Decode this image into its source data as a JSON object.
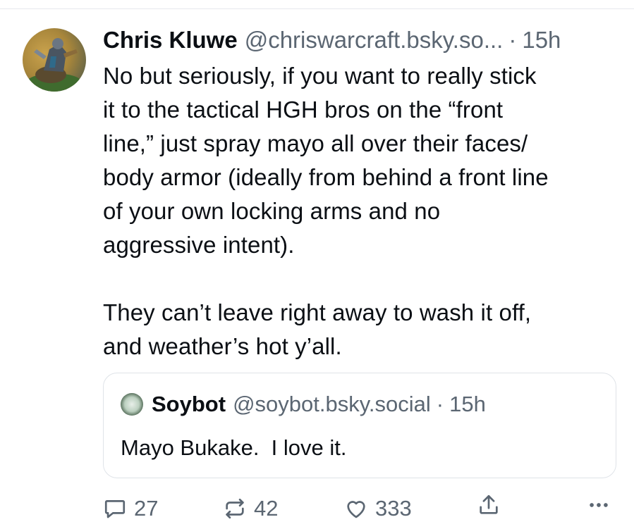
{
  "post": {
    "author_name": "Chris Kluwe",
    "author_handle": "@chriswarcraft.bsky.so...",
    "separator": "·",
    "timestamp": "15h",
    "text": "No but seriously, if you want to really stick\nit to the tactical HGH bros on the “front\nline,” just spray mayo all over their faces/\nbody armor (ideally from behind a front line\nof your own locking arms and no\naggressive intent).\n\nThey can’t leave right away to wash it off,\nand weather’s hot y’all."
  },
  "quote": {
    "author_name": "Soybot",
    "author_handle": "@soybot.bsky.social",
    "separator": "·",
    "timestamp": "15h",
    "text": "Mayo Bukake.  I love it."
  },
  "actions": {
    "reply_count": "27",
    "repost_count": "42",
    "like_count": "333"
  },
  "icons": {
    "reply": "speech-bubble-icon",
    "repost": "repost-arrows-icon",
    "like": "heart-icon",
    "share": "share-upload-icon",
    "more": "more-dots-icon"
  },
  "colors": {
    "text": "#0b0f14",
    "muted": "#5b6672",
    "border": "#dfe3e8"
  }
}
